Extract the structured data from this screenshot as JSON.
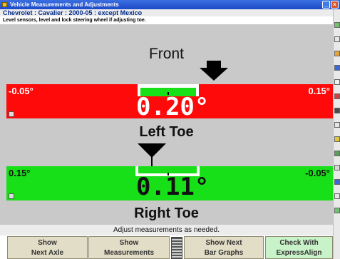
{
  "window": {
    "title": "Vehicle Measurements and Adjustments"
  },
  "vehicle": {
    "label": "Chevrolet : Cavalier : 2000-05 : except Mexico"
  },
  "instruction": "Level sensors, level and lock steering wheel if adjusting toe.",
  "axle_label": "Front",
  "left_toe": {
    "title": "Left Toe",
    "value": "0.20°",
    "min": "-0.05°",
    "max": "0.15°",
    "status": "out-of-spec",
    "bar_color": "#ff0a0a"
  },
  "right_toe": {
    "title": "Right Toe",
    "value": "0.11°",
    "min": "0.15°",
    "max": "-0.05°",
    "status": "in-spec",
    "bar_color": "#18e018"
  },
  "status_message": "Adjust measurements as needed.",
  "buttons": [
    {
      "line1": "Show",
      "line2": "Next Axle"
    },
    {
      "line1": "Show",
      "line2": "Measurements"
    },
    {
      "line1": "Show Next",
      "line2": "Bar Graphs"
    },
    {
      "line1": "Check With",
      "line2": "ExpressAlign"
    }
  ],
  "icons": [
    "app-icon",
    "minimize-icon",
    "close-icon",
    "lock-icon",
    "lock-icon",
    "bar-scale-icon"
  ]
}
